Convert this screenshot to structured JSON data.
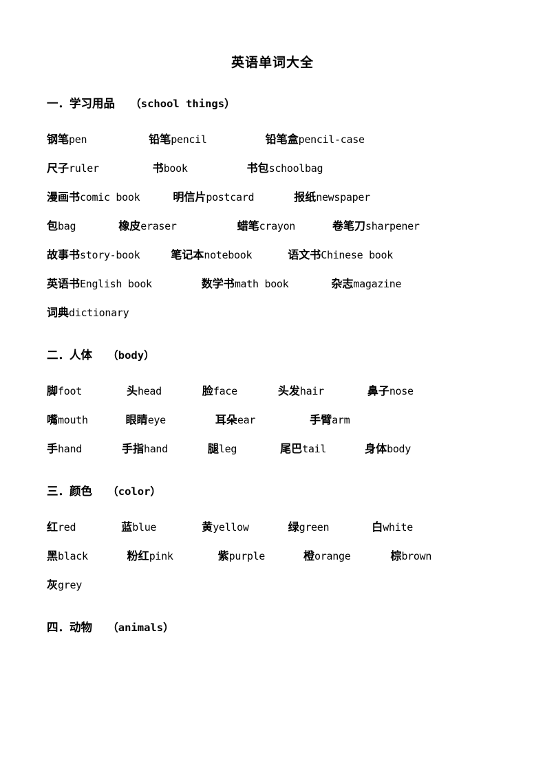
{
  "document": {
    "title": "英语单词大全"
  },
  "sections": [
    {
      "id": "school-things",
      "number": "一．",
      "zh_name": "学习用品",
      "en_name": "（school things）",
      "rows": [
        [
          {
            "zh": "钢笔",
            "en": "pen",
            "offset": 0
          },
          {
            "zh": "铅笔",
            "en": "pencil",
            "offset": 90
          },
          {
            "zh": "铅笔盒",
            "en": "pencil-case",
            "offset": 85
          }
        ],
        [
          {
            "zh": "尺子",
            "en": "ruler",
            "offset": 0
          },
          {
            "zh": "书",
            "en": "book",
            "offset": 78
          },
          {
            "zh": "书包",
            "en": "schoolbag",
            "offset": 86
          }
        ],
        [
          {
            "zh": "漫画书",
            "en": "comic book",
            "offset": 0
          },
          {
            "zh": "明信片",
            "en": "postcard",
            "offset": 48
          },
          {
            "zh": "报纸",
            "en": "newspaper",
            "offset": 58
          }
        ],
        [
          {
            "zh": "包",
            "en": "bag",
            "offset": 0
          },
          {
            "zh": "橡皮",
            "en": "eraser",
            "offset": 62
          },
          {
            "zh": "蜡笔",
            "en": "crayon",
            "offset": 88
          },
          {
            "zh": "卷笔刀",
            "en": "sharpener",
            "offset": 54
          }
        ],
        [
          {
            "zh": "故事书",
            "en": "story-book",
            "offset": 0
          },
          {
            "zh": "笔记本",
            "en": "notebook",
            "offset": 45
          },
          {
            "zh": "语文书",
            "en": "Chinese book",
            "offset": 52
          }
        ],
        [
          {
            "zh": "英语书",
            "en": "English book",
            "offset": 0
          },
          {
            "zh": "数学书",
            "en": "math book",
            "offset": 72
          },
          {
            "zh": "杂志",
            "en": "magazine",
            "offset": 62
          }
        ],
        [
          {
            "zh": "词典",
            "en": "dictionary",
            "offset": 0
          }
        ]
      ]
    },
    {
      "id": "body",
      "number": "二．",
      "zh_name": "人体",
      "en_name": "（body）",
      "rows": [
        [
          {
            "zh": "脚",
            "en": "foot",
            "offset": 0
          },
          {
            "zh": "头",
            "en": "head",
            "offset": 65
          },
          {
            "zh": "脸",
            "en": "face",
            "offset": 59
          },
          {
            "zh": "头发",
            "en": "hair",
            "offset": 59
          },
          {
            "zh": "鼻子",
            "en": "nose",
            "offset": 63
          }
        ],
        [
          {
            "zh": "嘴",
            "en": "mouth",
            "offset": 0
          },
          {
            "zh": "眼睛",
            "en": "eye",
            "offset": 55
          },
          {
            "zh": "耳朵",
            "en": "ear",
            "offset": 72
          },
          {
            "zh": "手臂",
            "en": "arm",
            "offset": 79
          }
        ],
        [
          {
            "zh": "手",
            "en": "hand",
            "offset": 0
          },
          {
            "zh": "手指",
            "en": "hand",
            "offset": 58
          },
          {
            "zh": "腿",
            "en": "leg",
            "offset": 58
          },
          {
            "zh": "尾巴",
            "en": "tail",
            "offset": 63
          },
          {
            "zh": "身体",
            "en": "body",
            "offset": 56
          }
        ]
      ]
    },
    {
      "id": "color",
      "number": "三．",
      "zh_name": "颜色",
      "en_name": "（color）",
      "rows": [
        [
          {
            "zh": "红",
            "en": "red",
            "offset": 0
          },
          {
            "zh": "蓝",
            "en": "blue",
            "offset": 66
          },
          {
            "zh": "黄",
            "en": "yellow",
            "offset": 66
          },
          {
            "zh": "绿",
            "en": "green",
            "offset": 57
          },
          {
            "zh": "白",
            "en": "white",
            "offset": 62
          }
        ],
        [
          {
            "zh": "黑",
            "en": "black",
            "offset": 0
          },
          {
            "zh": "粉红",
            "en": "pink",
            "offset": 57
          },
          {
            "zh": "紫",
            "en": "purple",
            "offset": 65
          },
          {
            "zh": "橙",
            "en": "orange",
            "offset": 56
          },
          {
            "zh": "棕",
            "en": "brown",
            "offset": 58
          }
        ],
        [
          {
            "zh": "灰",
            "en": "grey",
            "offset": 0
          }
        ]
      ]
    },
    {
      "id": "animals",
      "number": "四．",
      "zh_name": "动物",
      "en_name": "（animals）",
      "rows": []
    }
  ]
}
